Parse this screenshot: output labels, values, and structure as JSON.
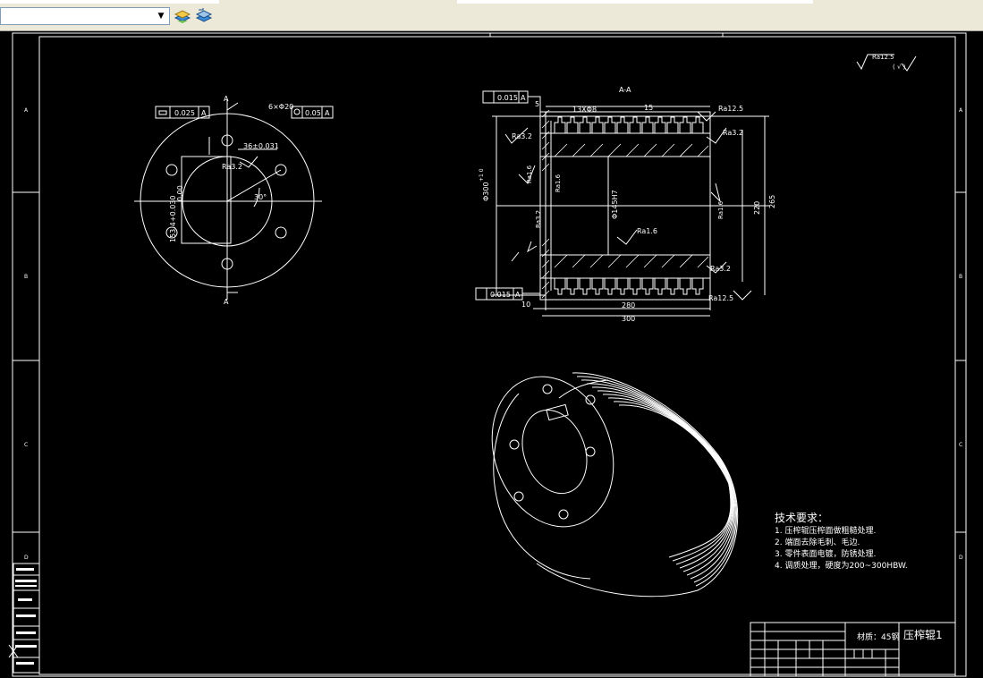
{
  "toolbar": {
    "layer_value": "",
    "buttons": [
      {
        "name": "layer-states-icon"
      },
      {
        "name": "layer-previous-icon"
      }
    ]
  },
  "drawing": {
    "surface_mark_top": "Ra12.5",
    "surface_mark_top_paren": "( √ )",
    "front": {
      "flatness_value": "0.025",
      "flatness_datum": "A",
      "holes_label": "6×Φ20",
      "holes_position_value": "0.05",
      "holes_position_datum": "A",
      "keyway_dim": "36±0.031",
      "keyway_ra": "Ra3.2",
      "bore_dim": "153.4+0.030",
      "bore_dim2": "0.00",
      "angle_label": "30°",
      "section_label": "A"
    },
    "section": {
      "title": "A-A",
      "runout_top_value": "0.015",
      "runout_top_datum": "A",
      "runout_bottom_value": "0.015",
      "runout_bottom_datum": "A",
      "dim_5": "5",
      "dim_grooves": "13XΦ8",
      "dim_15": "15",
      "ra_right_top": "Ra12.5",
      "ra_left": "Ra3.2",
      "ra_right_2": "Ra3.2",
      "ra_left_vert": "Ra1.6",
      "ra_inner": "Ra1.6",
      "ra_inner_right": "Ra1.6",
      "ra_left_vert2": "Ra3.2",
      "ra_inner_bottom": "Ra1.6",
      "ra_bottom_right": "Ra3.2",
      "ra_bottom": "Ra12.5",
      "dia_outer": "Φ300",
      "dia_outer_tol": "+1 0",
      "dia_bore": "Φ145H7",
      "dim_220": "220",
      "dim_265": "265",
      "dim_10": "10",
      "dim_280": "280",
      "dim_300": "300"
    },
    "tech_requirements": {
      "title": "技术要求：",
      "items": [
        "1. 压榨辊压榨面做粗糙处理.",
        "2. 端面去除毛刺、毛边.",
        "3. 零件表面电镀，防锈处理.",
        "4. 调质处理，硬度为200~300HBW."
      ]
    },
    "title_block": {
      "material": "材质：45钢",
      "part_name": "压榨辊1"
    },
    "border_letters_left": [
      "A",
      "B",
      "C",
      "D"
    ],
    "border_letters_right": [
      "A",
      "B",
      "C",
      "D"
    ]
  }
}
